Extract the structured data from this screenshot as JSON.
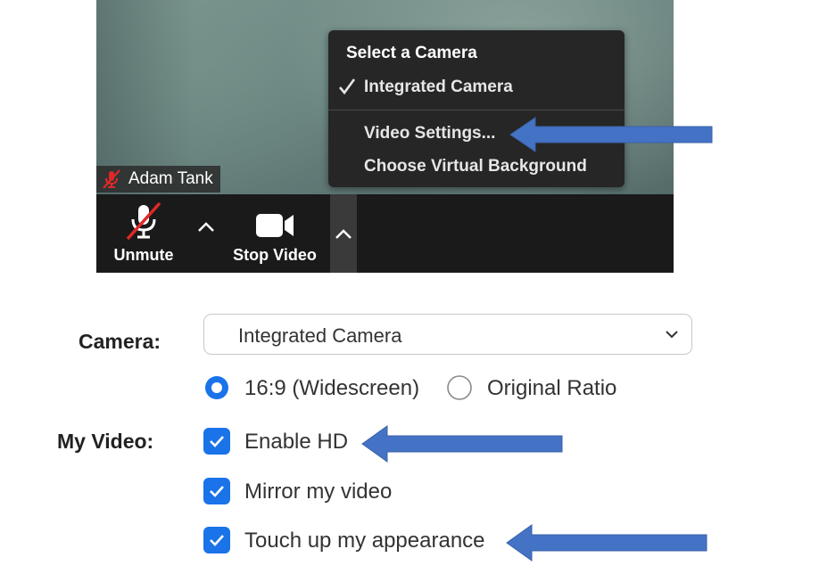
{
  "meeting": {
    "participant_name": "Adam Tank",
    "toolbar": {
      "unmute_label": "Unmute",
      "stop_video_label": "Stop Video"
    },
    "camera_menu": {
      "header": "Select a Camera",
      "items": [
        {
          "label": "Integrated Camera",
          "checked": true
        },
        {
          "label": "Video Settings..."
        },
        {
          "label": "Choose Virtual Background"
        }
      ]
    },
    "colors": {
      "toolbar_bg": "#1a1a1a",
      "menu_bg": "#262626",
      "muted_red": "#e02828"
    }
  },
  "settings": {
    "camera_label": "Camera:",
    "camera_value": "Integrated Camera",
    "aspect_options": [
      {
        "label": "16:9 (Widescreen)",
        "selected": true
      },
      {
        "label": "Original Ratio",
        "selected": false
      }
    ],
    "my_video_label": "My Video:",
    "checkboxes": [
      {
        "label": "Enable HD",
        "checked": true
      },
      {
        "label": "Mirror my video",
        "checked": true
      },
      {
        "label": "Touch up my appearance",
        "checked": true
      }
    ],
    "colors": {
      "accent": "#1a73e8"
    }
  },
  "annotations": {
    "arrow_color": "#4472c4"
  },
  "icons": {
    "muted_mic": "mic-off-icon",
    "video_camera": "video-camera-icon",
    "caret_up": "chevron-up-icon",
    "check": "check-icon",
    "select_chevron": "chevron-down-icon"
  }
}
